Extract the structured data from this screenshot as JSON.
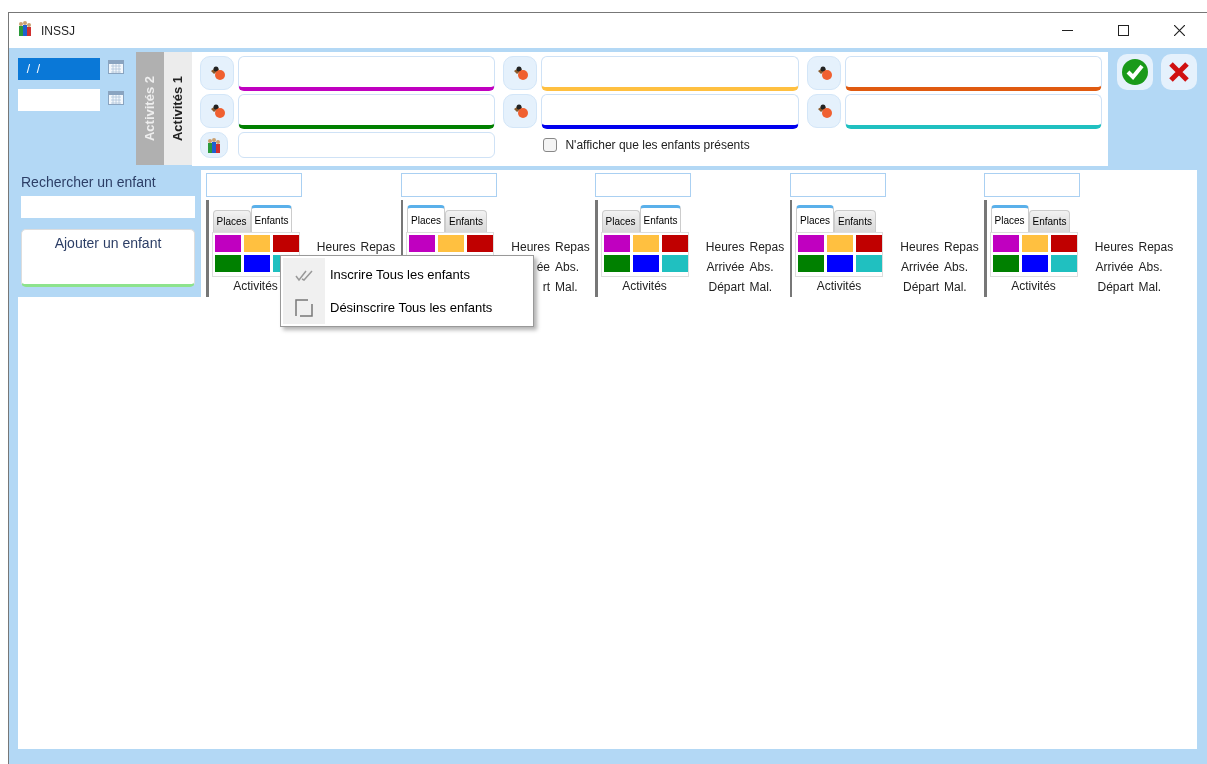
{
  "window": {
    "title": "INSSJ"
  },
  "dates": [
    {
      "value": "  /  /",
      "selected": true
    },
    {
      "selected": false
    }
  ],
  "activity_tabs": [
    {
      "label": "Activités 2",
      "selected": false
    },
    {
      "label": "Activités 1",
      "selected": true
    }
  ],
  "activity_slots": [
    {
      "kind": "activity",
      "color": "#c000c0"
    },
    {
      "kind": "activity",
      "color": "#ffc040"
    },
    {
      "kind": "activity",
      "color": "#e05a10"
    },
    {
      "kind": "activity",
      "color": "#008000"
    },
    {
      "kind": "activity",
      "color": "#0000ee"
    },
    {
      "kind": "activity",
      "color": "#20c0c0"
    },
    {
      "kind": "group"
    }
  ],
  "show_present_only": {
    "label": "N'afficher que les enfants présents",
    "checked": false
  },
  "search": {
    "label": "Rechercher un enfant"
  },
  "add_button": {
    "label": "Ajouter un enfant"
  },
  "columns": [
    {
      "tabs": [
        {
          "label": "Places",
          "selected": false
        },
        {
          "label": "Enfants",
          "selected": true
        }
      ],
      "swatches": [
        {
          "color": "#c000c0"
        },
        {
          "color": "#ffc040"
        },
        {
          "color": "#c00000"
        },
        {
          "color": "#008000"
        },
        {
          "color": "#0000ff"
        },
        {
          "color": "#20c0c0"
        }
      ],
      "labels": [
        "Heures",
        "Repas"
      ],
      "footer": "Activités"
    },
    {
      "tabs": [
        {
          "label": "Places",
          "selected": true
        },
        {
          "label": "Enfants",
          "selected": false
        }
      ],
      "swatches": [
        {
          "color": "#c000c0"
        },
        {
          "color": "#ffc040"
        },
        {
          "color": "#c00000"
        }
      ],
      "labels": [
        "Heures",
        "Repas",
        "ée",
        "Abs.",
        "rt",
        "Mal."
      ]
    },
    {
      "tabs": [
        {
          "label": "Places",
          "selected": false
        },
        {
          "label": "Enfants",
          "selected": true
        }
      ],
      "swatches": [
        {
          "color": "#c000c0"
        },
        {
          "color": "#ffc040"
        },
        {
          "color": "#c00000"
        },
        {
          "color": "#008000"
        },
        {
          "color": "#0000ff"
        },
        {
          "color": "#20c0c0"
        }
      ],
      "labels": [
        "Heures",
        "Repas",
        "Arrivée",
        "Abs.",
        "Départ",
        "Mal."
      ],
      "footer": "Activités"
    },
    {
      "tabs": [
        {
          "label": "Places",
          "selected": true
        },
        {
          "label": "Enfants",
          "selected": false
        }
      ],
      "swatches": [
        {
          "color": "#c000c0"
        },
        {
          "color": "#ffc040"
        },
        {
          "color": "#c00000"
        },
        {
          "color": "#008000"
        },
        {
          "color": "#0000ff"
        },
        {
          "color": "#20c0c0"
        }
      ],
      "labels": [
        "Heures",
        "Repas",
        "Arrivée",
        "Abs.",
        "Départ",
        "Mal."
      ],
      "footer": "Activités"
    },
    {
      "tabs": [
        {
          "label": "Places",
          "selected": true
        },
        {
          "label": "Enfants",
          "selected": false
        }
      ],
      "swatches": [
        {
          "color": "#c000c0"
        },
        {
          "color": "#ffc040"
        },
        {
          "color": "#c00000"
        },
        {
          "color": "#008000"
        },
        {
          "color": "#0000ff"
        },
        {
          "color": "#20c0c0"
        }
      ],
      "labels": [
        "Heures",
        "Repas",
        "Arrivée",
        "Abs.",
        "Départ",
        "Mal."
      ],
      "footer": "Activités"
    }
  ],
  "context_menu": {
    "items": [
      {
        "kind": "check-all",
        "label": "Inscrire Tous les enfants"
      },
      {
        "kind": "uncheck-all",
        "label": "Désinscrire Tous les enfants"
      }
    ]
  }
}
